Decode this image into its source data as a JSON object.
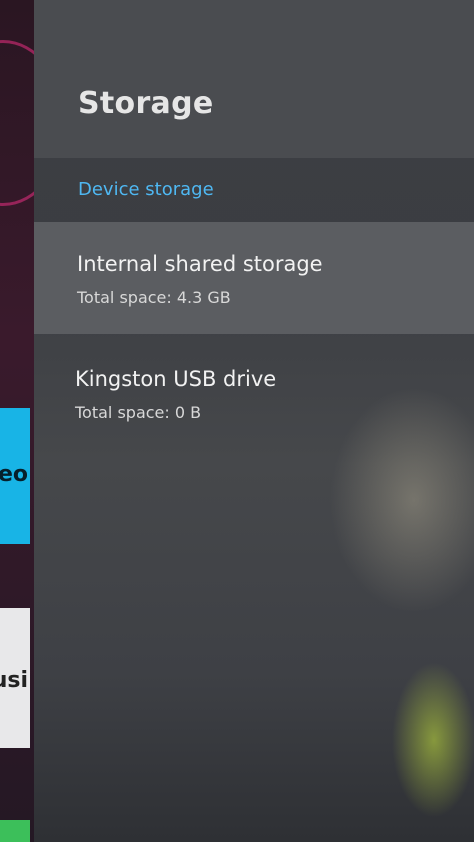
{
  "background": {
    "tiles": [
      {
        "label": "eo",
        "color": "#18b4e6"
      },
      {
        "label": "usi",
        "color": "#e8e8ea"
      }
    ]
  },
  "settings": {
    "title": "Storage",
    "section": "Device storage",
    "items": [
      {
        "title": "Internal shared storage",
        "subtitle": "Total space: 4.3 GB",
        "selected": true
      },
      {
        "title": "Kingston USB drive",
        "subtitle": "Total space: 0 B",
        "selected": false
      }
    ]
  },
  "colors": {
    "accent": "#4fb8f2",
    "panel": "#3d3f44",
    "selected_row": "#5b5d61"
  }
}
